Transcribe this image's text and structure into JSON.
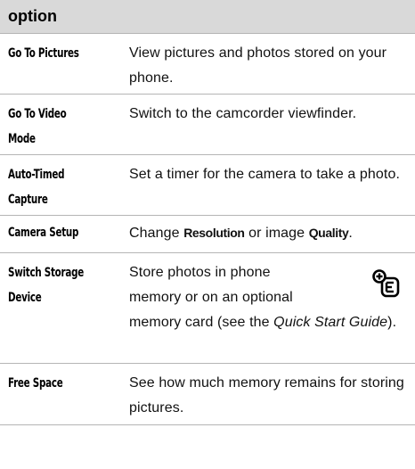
{
  "header": {
    "label": "option"
  },
  "rows": [
    {
      "option": "Go To Pictures",
      "desc": "View pictures and photos stored on your phone."
    },
    {
      "option_lines": [
        "Go To Video",
        "Mode"
      ],
      "desc": "Switch to the camcorder viewfinder."
    },
    {
      "option_lines": [
        "Auto-Timed",
        "Capture"
      ],
      "desc": "Set a timer for the camera to take a photo."
    },
    {
      "option": "Camera Setup",
      "desc_parts": {
        "before": "Change ",
        "bold1": "Resolution",
        "middle": " or image ",
        "bold2": "Quality",
        "after": "."
      }
    },
    {
      "option_lines": [
        "Switch Storage",
        "Device"
      ],
      "desc_parts": {
        "line1": "Store photos in phone",
        "line2": "memory or on an optional",
        "line3_before": "memory card (see the ",
        "italic": "Quick Start Guide",
        "after": ")."
      },
      "icon": "memory-card-optional-icon"
    },
    {
      "option": "Free Space",
      "desc": "See how much memory remains for storing pictures."
    }
  ]
}
